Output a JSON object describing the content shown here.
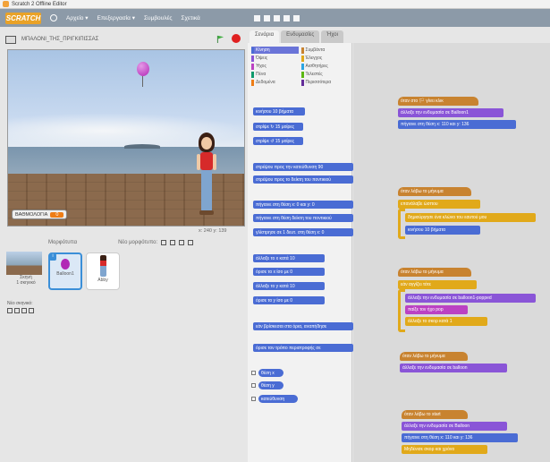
{
  "window": {
    "title": "Scratch 2 Offline Editor"
  },
  "menubar": {
    "logo": "SCRATCH",
    "items": [
      "Αρχείο ▾",
      "Επεξεργασία ▾",
      "Συμβουλές",
      "Σχετικά"
    ]
  },
  "stage": {
    "project_name": "ΜΠΑΛΟΝΙ_ΤΗΣ_ΠΡΙΓΚΙΠΙΣΣΑΣ",
    "variable_name": "ΒΑΘΜΟΛΟΓΙΑ",
    "variable_value": "0",
    "coords": "x: 240  y: 139"
  },
  "sprites": {
    "header": "Μορφότυπα",
    "new_sprite": "Νέο μορφότυπο:",
    "stage_label": "Σκηνή",
    "stage_sub": "1 σκηνικό",
    "sprite1": "Balloon1",
    "sprite2": "Abby",
    "new_backdrop": "Νέο σκηνικό:"
  },
  "tabs": [
    "Σενάρια",
    "Ενδυμασίες",
    "Ήχοι"
  ],
  "categories": [
    {
      "name": "Κίνηση",
      "color": "#4a6cd4"
    },
    {
      "name": "Συμβάντα",
      "color": "#c88330"
    },
    {
      "name": "Όψεις",
      "color": "#8a55d7"
    },
    {
      "name": "Έλεγχος",
      "color": "#e1a91a"
    },
    {
      "name": "Ήχος",
      "color": "#bb42c3"
    },
    {
      "name": "Αισθητήρες",
      "color": "#2ca5e2"
    },
    {
      "name": "Πένα",
      "color": "#0e9a6c"
    },
    {
      "name": "Τελεστές",
      "color": "#5cb712"
    },
    {
      "name": "Δεδομένα",
      "color": "#ee7d16"
    },
    {
      "name": "Περισσότερα",
      "color": "#632d99"
    }
  ],
  "palette_blocks": [
    "κινήσου 10 βήματα",
    "στρίψε ↻ 15 μοίρες",
    "στρίψε ↺ 15 μοίρες",
    "στρέψου προς την κατεύθυνση 90",
    "στρέψου προς το δείκτη του ποντικιού",
    "πήγαινε στη θέση x: 0 και y: 0",
    "πήγαινε στη θέση δείκτη του ποντικιού",
    "γλίστρησε σε 1 δευτ. στη θέση x: 0",
    "άλλαξε το x κατά 10",
    "όρισε το x ίσο με 0",
    "άλλαξε το y κατά 10",
    "όρισε το y ίσο με 0",
    "εάν βρίσκεσαι στα όρια, αναπήδησε",
    "όρισε τον τρόπο περιστροφής σε",
    "θέση x",
    "θέση y",
    "κατεύθυνση"
  ],
  "scripts": {
    "s1": [
      "όταν στο 🏳 γίνει κλικ",
      "άλλαξε την ενδυμασία σε Balloon1",
      "πήγαινε στη θέση x: 110 και y: 136"
    ],
    "s2": [
      "όταν λάβω το μήνυμα",
      "επανάλαβε ώσπου",
      "δημιούργησε ένα κλώνο του εαυτού μου",
      "κινήσου 10 βήματα"
    ],
    "s3": [
      "όταν λάβω το μήνυμα",
      "εάν αγγίζει τότε",
      "άλλαξε την ενδυμασία σε balloon1-popped",
      "παίξε τον ήχο pop",
      "άλλαξε το σκορ κατά 1"
    ],
    "s4": [
      "όταν λάβω το μήνυμα",
      "άλλαξε την ενδυμασία σε balloon"
    ],
    "s5": [
      "όταν λάβω το start",
      "άλλαξε την ενδυμασία σε Balloon",
      "πήγαινε στη θέση x: 110 και y: 136",
      "Μηδένισε σκορ και χρόνο"
    ]
  }
}
